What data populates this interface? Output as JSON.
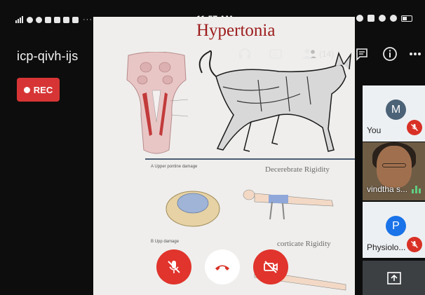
{
  "status_bar": {
    "time": "11:57 AM",
    "overflow": "···"
  },
  "meeting": {
    "code": "icp-qivh-ijs",
    "rec_label": "REC"
  },
  "toolbar": {
    "participants_count": "(14)",
    "icons": [
      "headphones-icon",
      "captions-icon",
      "people-icon",
      "chat-icon",
      "info-icon",
      "more-icon"
    ]
  },
  "slide": {
    "title": "Hypertonia",
    "caption_decerebrate": "Decerebrate Rigidity",
    "caption_decorticate": "corticate Rigidity",
    "label_a": "A  Upper pontine damage",
    "label_b": "B  Upp      damage"
  },
  "participants": [
    {
      "name": "You",
      "initial": "M",
      "muted": true
    },
    {
      "name": "vindtha s...",
      "initial": "",
      "muted": false,
      "speaking": true
    },
    {
      "name": "Physiolo...",
      "initial": "P",
      "muted": true
    }
  ],
  "colors": {
    "rec_red": "#d73535",
    "control_red": "#e0342c",
    "end_call_red": "#d93025",
    "slide_title": "#9c1b1b",
    "avatar_you": "#4b6277",
    "avatar_phys": "#1a73e8"
  }
}
